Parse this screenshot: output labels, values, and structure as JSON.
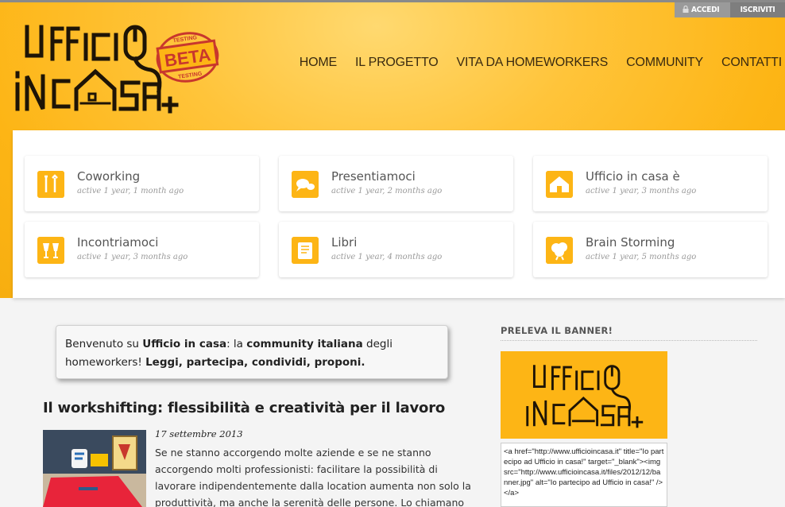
{
  "auth": {
    "login": "ACCEDI",
    "register": "ISCRIVITI"
  },
  "logo": {
    "top": "UFFICIO",
    "bottom": "IN CASA+",
    "stamp": "BETA",
    "stamp_small": "TESTING"
  },
  "nav": [
    "HOME",
    "IL PROGETTO",
    "VITA DA HOMEWORKERS",
    "COMMUNITY",
    "CONTATTI"
  ],
  "groups": [
    {
      "title": "Coworking",
      "meta": "active 1 year, 1 month ago",
      "icon": "tools-icon"
    },
    {
      "title": "Presentiamoci",
      "meta": "active 1 year, 2 months ago",
      "icon": "chat-icon"
    },
    {
      "title": "Ufficio in casa è",
      "meta": "active 1 year, 3 months ago",
      "icon": "house-icon"
    },
    {
      "title": "Incontriamoci",
      "meta": "active 1 year, 3 months ago",
      "icon": "glasses-icon"
    },
    {
      "title": "Libri",
      "meta": "active 1 year, 4 months ago",
      "icon": "book-icon"
    },
    {
      "title": "Brain Storming",
      "meta": "active 1 year, 5 months ago",
      "icon": "brain-icon"
    }
  ],
  "welcome": {
    "t1": "Benvenuto su ",
    "b1": "Ufficio in casa",
    "t2": ": la ",
    "b2": "community italiana",
    "t3": " degli homeworkers! ",
    "b3": "Leggi, partecipa, condividi, proponi."
  },
  "post": {
    "title": "Il workshifting: flessibilità e creatività per il lavoro",
    "date": "17 settembre 2013",
    "excerpt": "Se ne stanno accorgendo molte aziende e se ne stanno accorgendo molti professionisti: facilitare la possibilità di lavorare indipendentemente dalla location aumenta non solo la produttività, ma anche la serenità delle persone. Lo chiamano Workshifting e"
  },
  "sidebar": {
    "heading": "PRELEVA IL BANNER!",
    "code": "<a href=\"http://www.ufficioincasa.it\" title=\"Io partecipo ad Ufficio in casa!\" target=\"_blank\"><img src=\"http://www.ufficioincasa.it/files/2012/12/banner.jpg\" alt=\"Io partecipo ad Ufficio in casa!\" /></a>"
  },
  "colors": {
    "brand": "#fdb515",
    "dark": "#2a1c08",
    "stamp": "#c8372d"
  }
}
